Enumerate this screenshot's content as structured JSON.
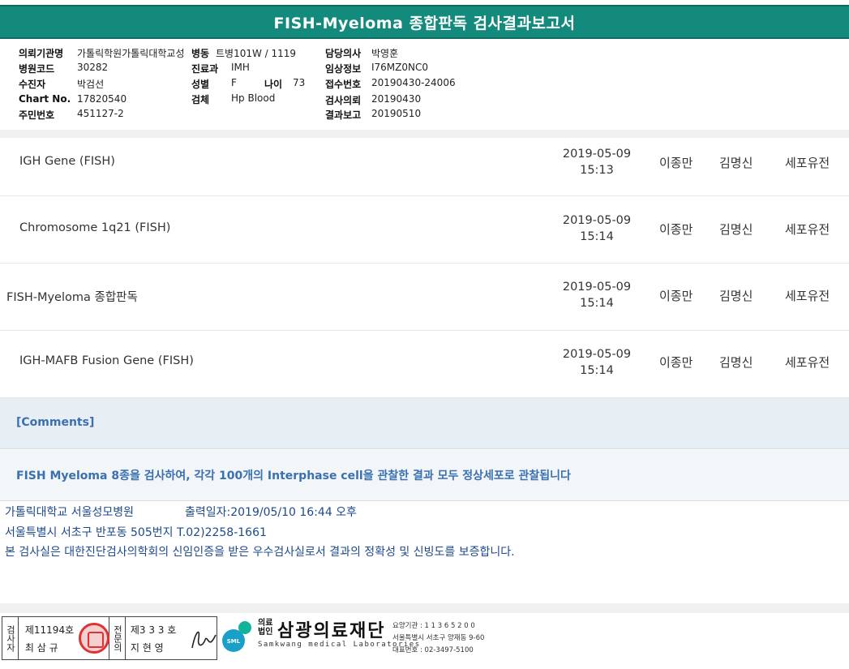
{
  "title": "FISH-Myeloma 종합판독 검사결과보고서",
  "info": {
    "institution_label": "의뢰기관명",
    "institution_value": "가톨릭학원가톨릭대학교성",
    "ward_label": "병동",
    "ward_value": "트병101W / 1119",
    "doctor_label": "담당의사",
    "doctor_value": "박영훈",
    "hospital_code_label": "병원코드",
    "hospital_code_value": "30282",
    "department_label": "진료과",
    "department_value": "IMH",
    "clinical_label": "임상정보",
    "clinical_value": "I76MZ0NC0",
    "patient_label": "수진자",
    "patient_value": "박검선",
    "sex_label": "성별",
    "sex_value": "F",
    "age_label": "나이",
    "age_value": "73",
    "receipt_label": "접수번호",
    "receipt_value": "20190430-24006",
    "chart_label": "Chart No.",
    "chart_value": "17820540",
    "specimen_label": "검체",
    "specimen_value": "Hp Blood",
    "request_label": "검사의뢰",
    "request_value": "20190430",
    "id_label": "주민번호",
    "id_value": "451127-2",
    "report_label": "결과보고",
    "report_value": "20190510"
  },
  "rows": [
    {
      "name": "IGH Gene (FISH)",
      "date": "2019-05-09",
      "time": "15:13",
      "p1": "이종만",
      "p2": "김명신",
      "dept": "세포유전"
    },
    {
      "name": "Chromosome 1q21 (FISH)",
      "date": "2019-05-09",
      "time": "15:14",
      "p1": "이종만",
      "p2": "김명신",
      "dept": "세포유전"
    },
    {
      "name": "FISH-Myeloma 종합판독",
      "date": "2019-05-09",
      "time": "15:14",
      "p1": "이종만",
      "p2": "김명신",
      "dept": "세포유전"
    },
    {
      "name": "IGH-MAFB Fusion Gene (FISH)",
      "date": "2019-05-09",
      "time": "15:14",
      "p1": "이종만",
      "p2": "김명신",
      "dept": "세포유전"
    }
  ],
  "comments": {
    "heading": "[Comments]",
    "text": "FISH Myeloma 8종을 검사하여, 각각 100개의 Interphase cell을 관찰한 결과 모두 정상세포로 관찰됩니다"
  },
  "footer": {
    "hospital": "가톨릭대학교 서울성모병원",
    "print_date": "출력일자:2019/05/10 16:44 오후",
    "address": "서울특별시 서초구 반포동 505번지 T.02)2258-1661",
    "certification": "본 검사실은 대한진단검사의학회의 신임인증을 받은 우수검사실로서 결과의 정확성 및 신빙도를 보증합니다."
  },
  "signature": {
    "examiner_label": "검사자",
    "examiner_no": "제11194호",
    "examiner_name": "최 삼 규",
    "specialist_label": "전문의",
    "specialist_no": "제3 3 3 호",
    "specialist_name": "지 현 영"
  },
  "org": {
    "small_line1": "의료",
    "small_line2": "법인",
    "name": "삼광의료재단",
    "english": "Samkwang medical Laboratories",
    "logo_text": "SML",
    "code": "요양기관 : 1 1 3 6 5 2 0 0",
    "address": "서울특별시 서초구 양재동 9-60",
    "phone": "대표번호 : 02-3497-5100"
  }
}
